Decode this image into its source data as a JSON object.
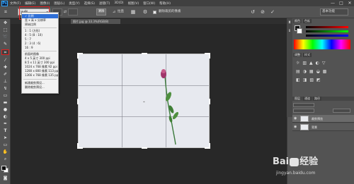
{
  "app": {
    "logo": "Ps"
  },
  "menu": [
    "文件(F)",
    "编辑(E)",
    "图像(I)",
    "图层(L)",
    "类型(Y)",
    "选择(S)",
    "滤镜(T)",
    "3D(D)",
    "视图(V)",
    "窗口(W)",
    "帮助(H)"
  ],
  "window_controls": [
    "—",
    "□",
    "✕"
  ],
  "options": {
    "ratio_value": "比例",
    "straighten_label": "拉直",
    "clear_label": "清除",
    "delete_cropped_label": "删除裁剪的像素",
    "preset": "基本功能"
  },
  "tab": {
    "title": "照片.jpg @ 33.3%(RGB/8)"
  },
  "dropdown": {
    "selected": "比例",
    "items1": [
      "宽 x 高 x 分辨率",
      "原始比例"
    ],
    "items2": [
      "1 : 1 (方形)",
      "4 : 5 (8 : 10)",
      "5 : 7",
      "2 : 3 (4 : 6)",
      "16 : 9"
    ],
    "section_title": "前面的图像",
    "items3": [
      "4 x 5 英寸 300 ppi",
      "8.5 x 11 英寸 300 ppi",
      "1024 x 768 像素 92 ppi",
      "1280 x 800 像素 113 ppi",
      "1366 x 768 像素 135 ppi"
    ],
    "items4": [
      "新建裁剪预设...",
      "删除裁剪预设..."
    ]
  },
  "panels": {
    "color_tab": "颜色",
    "swatches_tab": "色板",
    "adjust_tab": "调整",
    "styles_tab": "样式",
    "layers_tab": "图层",
    "channels_tab": "通道",
    "paths_tab": "路径",
    "layers": [
      {
        "name": "裁剪预览"
      },
      {
        "name": "背景"
      }
    ]
  },
  "watermark": {
    "logo_left": "Bai",
    "logo_right": "经验",
    "url": "jingyan.baidu.com"
  },
  "colors": {
    "accent": "#e02020",
    "selection": "#2f6fd6"
  }
}
